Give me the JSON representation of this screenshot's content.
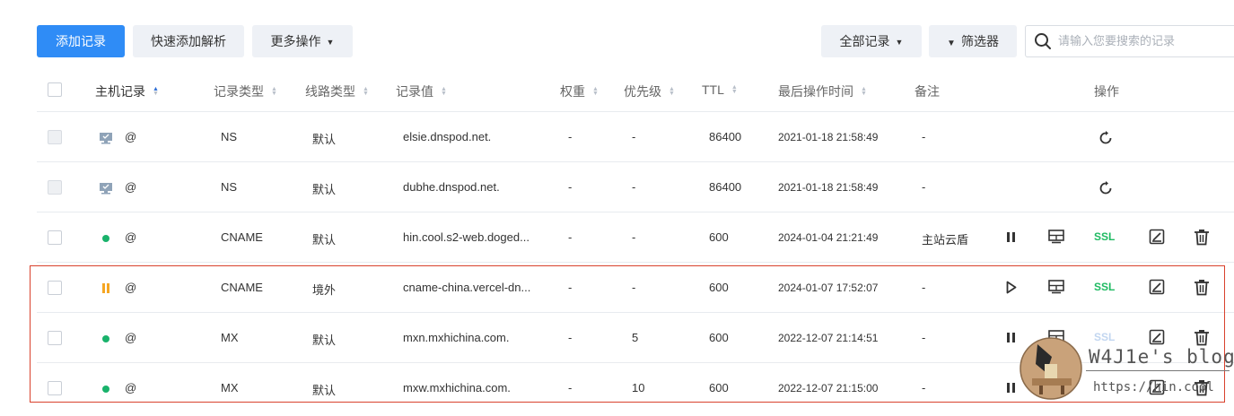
{
  "toolbar": {
    "add_record": "添加记录",
    "quick_add": "快速添加解析",
    "more_actions": "更多操作",
    "all_records": "全部记录",
    "filter": "筛选器",
    "search_placeholder": "请输入您要搜索的记录"
  },
  "table": {
    "headers": {
      "host": "主机记录",
      "type": "记录类型",
      "line": "线路类型",
      "value": "记录值",
      "weight": "权重",
      "priority": "优先级",
      "ttl": "TTL",
      "time": "最后操作时间",
      "remark": "备注",
      "actions": "操作"
    },
    "rows": [
      {
        "host": "@",
        "type": "NS",
        "line": "默认",
        "value": "elsie.dnspod.net.",
        "weight": "-",
        "priority": "-",
        "ttl": "86400",
        "time": "2021-01-18 21:58:49",
        "remark": "-",
        "status": "system"
      },
      {
        "host": "@",
        "type": "NS",
        "line": "默认",
        "value": "dubhe.dnspod.net.",
        "weight": "-",
        "priority": "-",
        "ttl": "86400",
        "time": "2021-01-18 21:58:49",
        "remark": "-",
        "status": "system"
      },
      {
        "host": "@",
        "type": "CNAME",
        "line": "默认",
        "value": "hin.cool.s2-web.doged...",
        "weight": "-",
        "priority": "-",
        "ttl": "600",
        "time": "2024-01-04 21:21:49",
        "remark": "主站云盾",
        "status": "enabled",
        "ssl": "SSL"
      },
      {
        "host": "@",
        "type": "CNAME",
        "line": "境外",
        "value": "cname-china.vercel-dn...",
        "weight": "-",
        "priority": "-",
        "ttl": "600",
        "time": "2024-01-07 17:52:07",
        "remark": "-",
        "status": "paused",
        "ssl": "SSL"
      },
      {
        "host": "@",
        "type": "MX",
        "line": "默认",
        "value": "mxn.mxhichina.com.",
        "weight": "-",
        "priority": "5",
        "ttl": "600",
        "time": "2022-12-07 21:14:51",
        "remark": "-",
        "status": "enabled",
        "ssl": "SSL"
      },
      {
        "host": "@",
        "type": "MX",
        "line": "默认",
        "value": "mxw.mxhichina.com.",
        "weight": "-",
        "priority": "10",
        "ttl": "600",
        "time": "2022-12-07 21:15:00",
        "remark": "-",
        "status": "enabled"
      }
    ]
  },
  "watermark": {
    "text": "W4J1e's blog",
    "url": "https://hin.cool"
  },
  "colors": {
    "primary": "#2f8cf6",
    "enabled": "#19b26b",
    "paused": "#f5a623",
    "ssl": "#1fba62",
    "highlight": "#d9412c"
  }
}
